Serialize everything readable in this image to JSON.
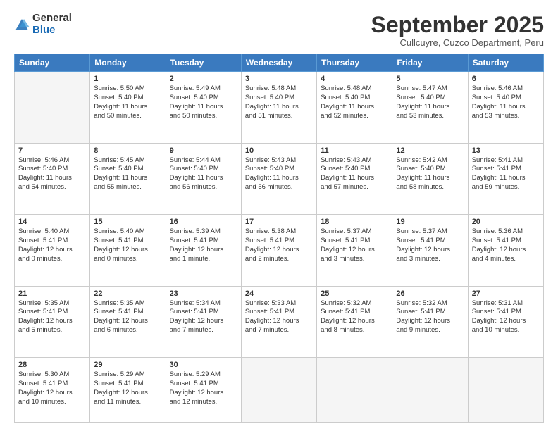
{
  "logo": {
    "general": "General",
    "blue": "Blue"
  },
  "header": {
    "month": "September 2025",
    "location": "Cullcuyre, Cuzco Department, Peru"
  },
  "weekdays": [
    "Sunday",
    "Monday",
    "Tuesday",
    "Wednesday",
    "Thursday",
    "Friday",
    "Saturday"
  ],
  "weeks": [
    [
      {
        "day": "",
        "info": ""
      },
      {
        "day": "1",
        "info": "Sunrise: 5:50 AM\nSunset: 5:40 PM\nDaylight: 11 hours\nand 50 minutes."
      },
      {
        "day": "2",
        "info": "Sunrise: 5:49 AM\nSunset: 5:40 PM\nDaylight: 11 hours\nand 50 minutes."
      },
      {
        "day": "3",
        "info": "Sunrise: 5:48 AM\nSunset: 5:40 PM\nDaylight: 11 hours\nand 51 minutes."
      },
      {
        "day": "4",
        "info": "Sunrise: 5:48 AM\nSunset: 5:40 PM\nDaylight: 11 hours\nand 52 minutes."
      },
      {
        "day": "5",
        "info": "Sunrise: 5:47 AM\nSunset: 5:40 PM\nDaylight: 11 hours\nand 53 minutes."
      },
      {
        "day": "6",
        "info": "Sunrise: 5:46 AM\nSunset: 5:40 PM\nDaylight: 11 hours\nand 53 minutes."
      }
    ],
    [
      {
        "day": "7",
        "info": "Sunrise: 5:46 AM\nSunset: 5:40 PM\nDaylight: 11 hours\nand 54 minutes."
      },
      {
        "day": "8",
        "info": "Sunrise: 5:45 AM\nSunset: 5:40 PM\nDaylight: 11 hours\nand 55 minutes."
      },
      {
        "day": "9",
        "info": "Sunrise: 5:44 AM\nSunset: 5:40 PM\nDaylight: 11 hours\nand 56 minutes."
      },
      {
        "day": "10",
        "info": "Sunrise: 5:43 AM\nSunset: 5:40 PM\nDaylight: 11 hours\nand 56 minutes."
      },
      {
        "day": "11",
        "info": "Sunrise: 5:43 AM\nSunset: 5:40 PM\nDaylight: 11 hours\nand 57 minutes."
      },
      {
        "day": "12",
        "info": "Sunrise: 5:42 AM\nSunset: 5:40 PM\nDaylight: 11 hours\nand 58 minutes."
      },
      {
        "day": "13",
        "info": "Sunrise: 5:41 AM\nSunset: 5:41 PM\nDaylight: 11 hours\nand 59 minutes."
      }
    ],
    [
      {
        "day": "14",
        "info": "Sunrise: 5:40 AM\nSunset: 5:41 PM\nDaylight: 12 hours\nand 0 minutes."
      },
      {
        "day": "15",
        "info": "Sunrise: 5:40 AM\nSunset: 5:41 PM\nDaylight: 12 hours\nand 0 minutes."
      },
      {
        "day": "16",
        "info": "Sunrise: 5:39 AM\nSunset: 5:41 PM\nDaylight: 12 hours\nand 1 minute."
      },
      {
        "day": "17",
        "info": "Sunrise: 5:38 AM\nSunset: 5:41 PM\nDaylight: 12 hours\nand 2 minutes."
      },
      {
        "day": "18",
        "info": "Sunrise: 5:37 AM\nSunset: 5:41 PM\nDaylight: 12 hours\nand 3 minutes."
      },
      {
        "day": "19",
        "info": "Sunrise: 5:37 AM\nSunset: 5:41 PM\nDaylight: 12 hours\nand 3 minutes."
      },
      {
        "day": "20",
        "info": "Sunrise: 5:36 AM\nSunset: 5:41 PM\nDaylight: 12 hours\nand 4 minutes."
      }
    ],
    [
      {
        "day": "21",
        "info": "Sunrise: 5:35 AM\nSunset: 5:41 PM\nDaylight: 12 hours\nand 5 minutes."
      },
      {
        "day": "22",
        "info": "Sunrise: 5:35 AM\nSunset: 5:41 PM\nDaylight: 12 hours\nand 6 minutes."
      },
      {
        "day": "23",
        "info": "Sunrise: 5:34 AM\nSunset: 5:41 PM\nDaylight: 12 hours\nand 7 minutes."
      },
      {
        "day": "24",
        "info": "Sunrise: 5:33 AM\nSunset: 5:41 PM\nDaylight: 12 hours\nand 7 minutes."
      },
      {
        "day": "25",
        "info": "Sunrise: 5:32 AM\nSunset: 5:41 PM\nDaylight: 12 hours\nand 8 minutes."
      },
      {
        "day": "26",
        "info": "Sunrise: 5:32 AM\nSunset: 5:41 PM\nDaylight: 12 hours\nand 9 minutes."
      },
      {
        "day": "27",
        "info": "Sunrise: 5:31 AM\nSunset: 5:41 PM\nDaylight: 12 hours\nand 10 minutes."
      }
    ],
    [
      {
        "day": "28",
        "info": "Sunrise: 5:30 AM\nSunset: 5:41 PM\nDaylight: 12 hours\nand 10 minutes."
      },
      {
        "day": "29",
        "info": "Sunrise: 5:29 AM\nSunset: 5:41 PM\nDaylight: 12 hours\nand 11 minutes."
      },
      {
        "day": "30",
        "info": "Sunrise: 5:29 AM\nSunset: 5:41 PM\nDaylight: 12 hours\nand 12 minutes."
      },
      {
        "day": "",
        "info": ""
      },
      {
        "day": "",
        "info": ""
      },
      {
        "day": "",
        "info": ""
      },
      {
        "day": "",
        "info": ""
      }
    ]
  ]
}
